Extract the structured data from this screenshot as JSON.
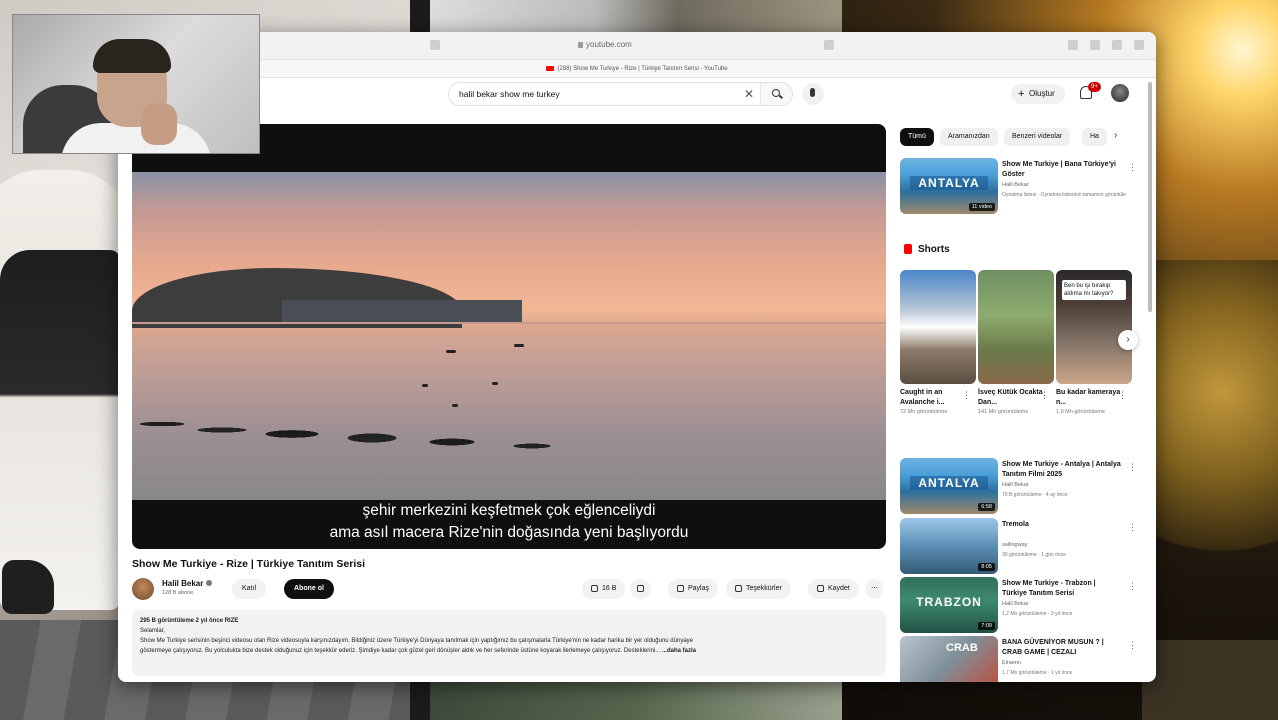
{
  "browser": {
    "url": "youtube.com",
    "tab_title": "(288) Show Me Turkiye - Rize | Türkiye Tanıtım Serisi - YouTube"
  },
  "header": {
    "search_query": "halil bekar show me turkey",
    "create_label": "Oluştur",
    "notification_count": "9+"
  },
  "player": {
    "subtitle_line1": "şehir merkezini keşfetmek çok eğlenceliydi",
    "subtitle_line2": "ama asıl macera Rize'nin doğasında yeni başlıyordu"
  },
  "video": {
    "title": "Show Me Turkiye - Rize | Türkiye Tanıtım Serisi",
    "channel_name": "Halil Bekar",
    "subscribers": "128 B abone",
    "join_label": "Katıl",
    "subscribe_label": "Abone ol",
    "likes": "16 B",
    "share_label": "Paylaş",
    "thanks_label": "Teşekkürler",
    "save_label": "Kaydet"
  },
  "description": {
    "meta": "295 B görüntüleme  2 yıl önce  RIZE",
    "greeting": "Selamlar,",
    "line1": "Show Me Turkiye serisinin beşinci videosu olan Rize videosuyla karşınızdayım. Bildiğiniz üzere Türkiye'yi Dünyaya tanıtmak için yaptığımız bu çalışmalarla Türkiye'nin ne kadar harika bir yer olduğunu dünyaye",
    "line2": "göstermeye çalışıyoruz. Bu yolculukta bize destek olduğunuz için teşekkür ederiz. Şimdiye kadar çok güzel geri dönüşler aldık ve her seferinde üstüne koyarak ilerlemeye çalışıyoruz. Desteklerini...",
    "more_label": "...daha fazla"
  },
  "chips": [
    "Tümü",
    "Aramanızdan",
    "Benzeri videolar",
    "Ha"
  ],
  "recommendations": [
    {
      "title": "Show Me Turkiye | Bana Türkiye'yi Göster",
      "channel": "Halil Bekar",
      "meta": "Oynatma listesi · Oynatma listesinin tamamını görüntüle",
      "badge": "11 video",
      "thumb_word": "ANTALYA"
    },
    {
      "title": "Show Me Turkiye - Antalya | Antalya Tanıtım Filmi 2025",
      "channel": "Halil Bekar",
      "meta": "70 B görüntüleme · 4 ay önce",
      "badge": "6:58",
      "thumb_word": "ANTALYA"
    },
    {
      "title": "Tremola",
      "channel": "sailingway",
      "meta": "30 görüntüleme · 1 gün önce",
      "badge": "8:05",
      "thumb_word": ""
    },
    {
      "title": "Show Me Turkiye - Trabzon | Türkiye Tanıtım Serisi",
      "channel": "Halil Bekar",
      "meta": "1,2 Mn görüntüleme · 3 yıl önce",
      "badge": "7:09",
      "thumb_word": "TRABZON"
    },
    {
      "title": "BANA GÜVENİYOR MUSUN ? | CRAB GAME | CEZALI",
      "channel": "Elraenn",
      "meta": "1,7 Mn görüntüleme · 1 yıl önce",
      "badge": "",
      "thumb_word": "CRAB"
    }
  ],
  "shorts": {
    "heading": "Shorts",
    "items": [
      {
        "title": "Caught in an Avalanche i...",
        "views": "72 Mn görüntüleme"
      },
      {
        "title": "İsveç Kütük Ocakta Dan...",
        "views": "141 Mn görüntüleme"
      },
      {
        "title": "Bu kadar kameraya n...",
        "views": "1,9 Mn görüntüleme",
        "caption": "Ben bu işi bırakıp aldıma mı takıyor?"
      }
    ]
  },
  "colors": {
    "accent": "#ff0000",
    "subscribe_bg": "#0f0f0f",
    "chip_active": "#0f0f0f"
  }
}
